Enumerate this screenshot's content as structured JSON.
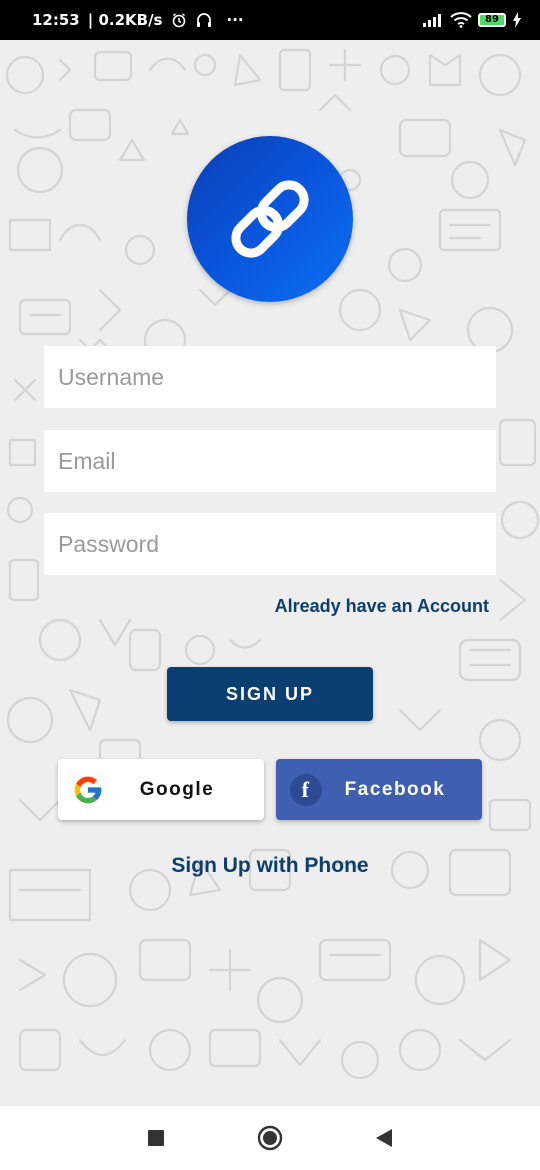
{
  "status_bar": {
    "time": "12:53",
    "speed": "| 0.2KB/s",
    "more": "···",
    "battery_level": "89",
    "icons": [
      "alarm-icon",
      "headset-icon",
      "signal-icon",
      "wifi-icon",
      "battery-icon",
      "charging-icon"
    ]
  },
  "logo": {
    "icon": "link-icon",
    "colors": [
      "#0a3fb5",
      "#0b6ff0"
    ]
  },
  "form": {
    "username_placeholder": "Username",
    "email_placeholder": "Email",
    "password_placeholder": "Password",
    "username_value": "",
    "email_value": "",
    "password_value": ""
  },
  "links": {
    "already_account": "Already have an Account",
    "phone_signup": "Sign Up with Phone"
  },
  "buttons": {
    "sign_up": "SIGN UP",
    "google": "Google",
    "facebook": "Facebook",
    "facebook_glyph": "f"
  },
  "nav": {
    "icons": [
      "square-recents-icon",
      "circle-home-icon",
      "triangle-back-icon"
    ]
  },
  "colors": {
    "primary": "#0b3f71",
    "facebook": "#3f5fb0",
    "background": "#eeeeee"
  }
}
